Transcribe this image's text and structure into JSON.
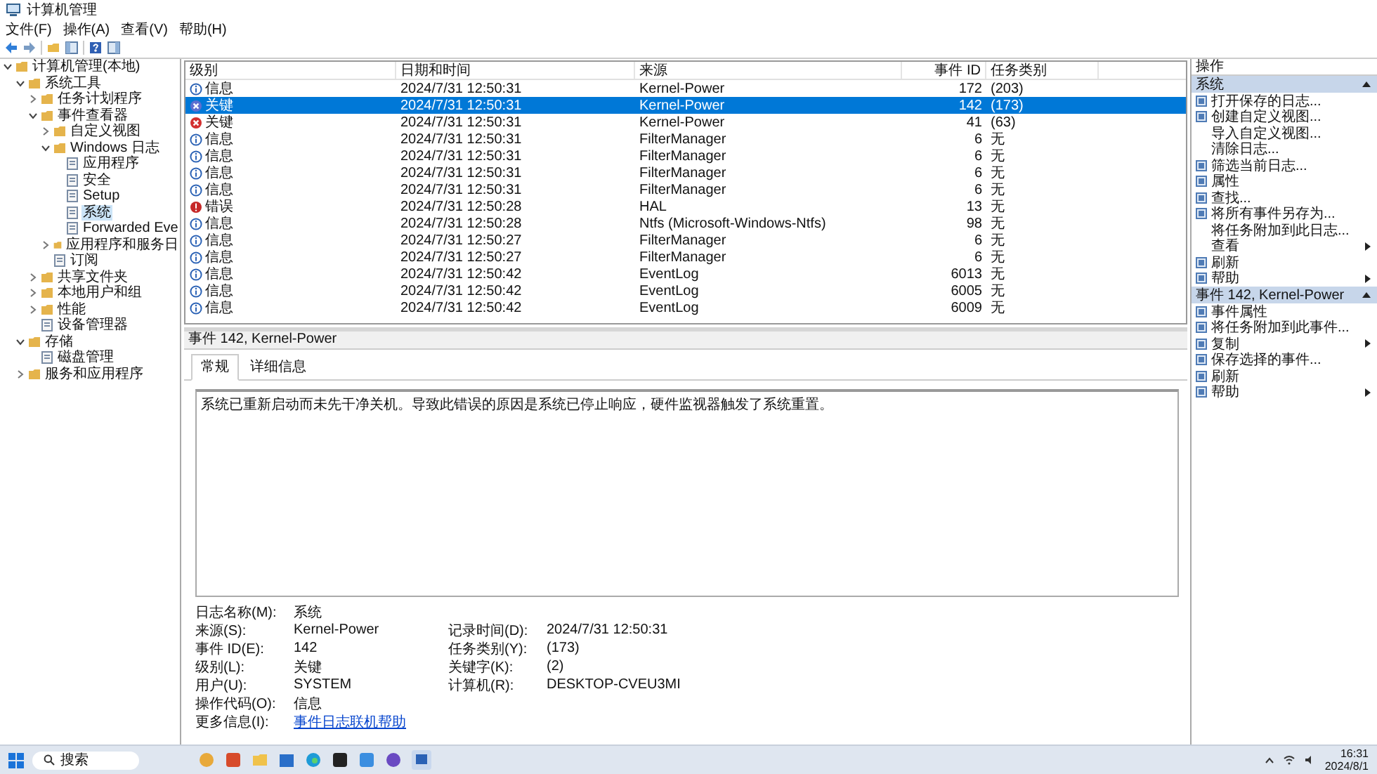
{
  "window": {
    "title": "计算机管理"
  },
  "menu": [
    "文件(F)",
    "操作(A)",
    "查看(V)",
    "帮助(H)"
  ],
  "tree": [
    {
      "label": "计算机管理(本地)",
      "expanded": true,
      "selected": false,
      "children": [
        {
          "label": "系统工具",
          "expanded": true,
          "selected": false,
          "children": [
            {
              "label": "任务计划程序",
              "expanded": false,
              "selected": false
            },
            {
              "label": "事件查看器",
              "expanded": true,
              "selected": false,
              "children": [
                {
                  "label": "自定义视图",
                  "expanded": false,
                  "selected": false
                },
                {
                  "label": "Windows 日志",
                  "expanded": true,
                  "selected": false,
                  "children": [
                    {
                      "label": "应用程序",
                      "selected": false
                    },
                    {
                      "label": "安全",
                      "selected": false
                    },
                    {
                      "label": "Setup",
                      "selected": false
                    },
                    {
                      "label": "系统",
                      "selected": true
                    },
                    {
                      "label": "Forwarded Eve",
                      "selected": false
                    }
                  ]
                },
                {
                  "label": "应用程序和服务日",
                  "expanded": false,
                  "selected": false
                },
                {
                  "label": "订阅",
                  "selected": false
                }
              ]
            },
            {
              "label": "共享文件夹",
              "expanded": false,
              "selected": false
            },
            {
              "label": "本地用户和组",
              "expanded": false,
              "selected": false
            },
            {
              "label": "性能",
              "expanded": false,
              "selected": false
            },
            {
              "label": "设备管理器",
              "selected": false
            }
          ]
        },
        {
          "label": "存储",
          "expanded": true,
          "selected": false,
          "children": [
            {
              "label": "磁盘管理",
              "selected": false
            }
          ]
        },
        {
          "label": "服务和应用程序",
          "expanded": false,
          "selected": false
        }
      ]
    }
  ],
  "events": {
    "columns": [
      "级别",
      "日期和时间",
      "来源",
      "事件 ID",
      "任务类别"
    ],
    "rows": [
      {
        "kind": "info",
        "level": "信息",
        "date": "2024/7/31 12:50:31",
        "source": "Kernel-Power",
        "id": "172",
        "category": "(203)",
        "selected": false
      },
      {
        "kind": "critical",
        "level": "关键",
        "date": "2024/7/31 12:50:31",
        "source": "Kernel-Power",
        "id": "142",
        "category": "(173)",
        "selected": true
      },
      {
        "kind": "critical",
        "level": "关键",
        "date": "2024/7/31 12:50:31",
        "source": "Kernel-Power",
        "id": "41",
        "category": "(63)",
        "selected": false
      },
      {
        "kind": "info",
        "level": "信息",
        "date": "2024/7/31 12:50:31",
        "source": "FilterManager",
        "id": "6",
        "category": "无",
        "selected": false
      },
      {
        "kind": "info",
        "level": "信息",
        "date": "2024/7/31 12:50:31",
        "source": "FilterManager",
        "id": "6",
        "category": "无",
        "selected": false
      },
      {
        "kind": "info",
        "level": "信息",
        "date": "2024/7/31 12:50:31",
        "source": "FilterManager",
        "id": "6",
        "category": "无",
        "selected": false
      },
      {
        "kind": "info",
        "level": "信息",
        "date": "2024/7/31 12:50:31",
        "source": "FilterManager",
        "id": "6",
        "category": "无",
        "selected": false
      },
      {
        "kind": "error",
        "level": "错误",
        "date": "2024/7/31 12:50:28",
        "source": "HAL",
        "id": "13",
        "category": "无",
        "selected": false
      },
      {
        "kind": "info",
        "level": "信息",
        "date": "2024/7/31 12:50:28",
        "source": "Ntfs (Microsoft-Windows-Ntfs)",
        "id": "98",
        "category": "无",
        "selected": false
      },
      {
        "kind": "info",
        "level": "信息",
        "date": "2024/7/31 12:50:27",
        "source": "FilterManager",
        "id": "6",
        "category": "无",
        "selected": false
      },
      {
        "kind": "info",
        "level": "信息",
        "date": "2024/7/31 12:50:27",
        "source": "FilterManager",
        "id": "6",
        "category": "无",
        "selected": false
      },
      {
        "kind": "info",
        "level": "信息",
        "date": "2024/7/31 12:50:42",
        "source": "EventLog",
        "id": "6013",
        "category": "无",
        "selected": false
      },
      {
        "kind": "info",
        "level": "信息",
        "date": "2024/7/31 12:50:42",
        "source": "EventLog",
        "id": "6005",
        "category": "无",
        "selected": false
      },
      {
        "kind": "info",
        "level": "信息",
        "date": "2024/7/31 12:50:42",
        "source": "EventLog",
        "id": "6009",
        "category": "无",
        "selected": false
      }
    ]
  },
  "detail": {
    "title": "事件 142, Kernel-Power",
    "tabs": [
      {
        "label": "常规",
        "selected": true
      },
      {
        "label": "详细信息",
        "selected": false
      }
    ],
    "description": "系统已重新启动而未先干净关机。导致此错误的原因是系统已停止响应，硬件监视器触发了系统重置。",
    "fields": [
      [
        {
          "label": "日志名称(M):",
          "value": "系统"
        }
      ],
      [
        {
          "label": "来源(S):",
          "value": "Kernel-Power"
        },
        {
          "label": "记录时间(D):",
          "value": "2024/7/31 12:50:31"
        }
      ],
      [
        {
          "label": "事件 ID(E):",
          "value": "142"
        },
        {
          "label": "任务类别(Y):",
          "value": "(173)"
        }
      ],
      [
        {
          "label": "级别(L):",
          "value": "关键"
        },
        {
          "label": "关键字(K):",
          "value": "(2)"
        }
      ],
      [
        {
          "label": "用户(U):",
          "value": "SYSTEM"
        },
        {
          "label": "计算机(R):",
          "value": "DESKTOP-CVEU3MI"
        }
      ],
      [
        {
          "label": "操作代码(O):",
          "value": "信息"
        }
      ],
      [
        {
          "label": "更多信息(I):",
          "value": "事件日志联机帮助",
          "kind": "link"
        }
      ]
    ]
  },
  "actions": {
    "title": "操作",
    "sections": [
      {
        "title": "系统",
        "expanded": true,
        "items": [
          {
            "label": "打开保存的日志...",
            "icon": true,
            "submenu": false
          },
          {
            "label": "创建自定义视图...",
            "icon": true,
            "submenu": false
          },
          {
            "label": "导入自定义视图...",
            "icon": false,
            "submenu": false
          },
          {
            "label": "清除日志...",
            "icon": false,
            "submenu": false
          },
          {
            "label": "筛选当前日志...",
            "icon": true,
            "submenu": false
          },
          {
            "label": "属性",
            "icon": true,
            "submenu": false
          },
          {
            "label": "查找...",
            "icon": true,
            "submenu": false
          },
          {
            "label": "将所有事件另存为...",
            "icon": true,
            "submenu": false
          },
          {
            "label": "将任务附加到此日志...",
            "icon": false,
            "submenu": false
          },
          {
            "label": "查看",
            "icon": false,
            "submenu": true
          },
          {
            "label": "刷新",
            "icon": true,
            "submenu": false
          },
          {
            "label": "帮助",
            "icon": true,
            "submenu": true
          }
        ]
      },
      {
        "title": "事件 142, Kernel-Power",
        "expanded": true,
        "items": [
          {
            "label": "事件属性",
            "icon": true,
            "submenu": false
          },
          {
            "label": "将任务附加到此事件...",
            "icon": true,
            "submenu": false
          },
          {
            "label": "复制",
            "icon": true,
            "submenu": true
          },
          {
            "label": "保存选择的事件...",
            "icon": true,
            "submenu": false
          },
          {
            "label": "刷新",
            "icon": true,
            "submenu": false
          },
          {
            "label": "帮助",
            "icon": true,
            "submenu": true
          }
        ]
      }
    ]
  },
  "taskbar": {
    "search": "搜索",
    "time": "16:31",
    "date": "2024/8/1"
  }
}
